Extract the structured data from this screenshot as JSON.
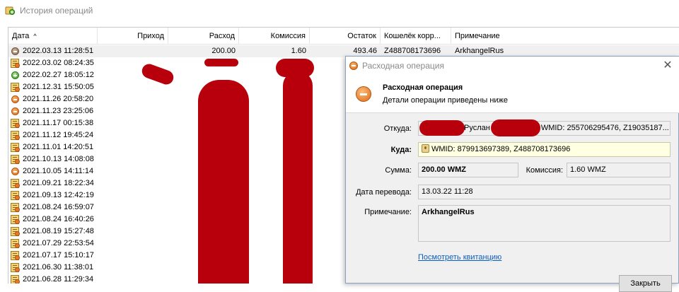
{
  "app": {
    "title": "История операций"
  },
  "table": {
    "columns": [
      "Дата",
      "Приход",
      "Расход",
      "Комиссия",
      "Остаток",
      "Кошелёк корр...",
      "Примечание"
    ],
    "sort_indicator": "^",
    "rows": [
      {
        "date": "2022.03.13 11:28:51",
        "icon": "grey-minus",
        "income": "",
        "expense": "200.00",
        "fee": "1.60",
        "balance": "493.46",
        "wallet": "Z488708173696",
        "note": "ArkhangelRus"
      },
      {
        "date": "2022.03.02 08:24:35",
        "icon": "doc"
      },
      {
        "date": "2022.02.27 18:05:12",
        "icon": "green-plus"
      },
      {
        "date": "2021.12.31 15:50:05",
        "icon": "doc"
      },
      {
        "date": "2021.11.26 20:58:20",
        "icon": "orange-minus"
      },
      {
        "date": "2021.11.23 23:25:06",
        "icon": "orange-minus"
      },
      {
        "date": "2021.11.17 00:15:38",
        "icon": "doc"
      },
      {
        "date": "2021.11.12 19:45:24",
        "icon": "doc"
      },
      {
        "date": "2021.11.01 14:20:51",
        "icon": "doc"
      },
      {
        "date": "2021.10.13 14:08:08",
        "icon": "doc"
      },
      {
        "date": "2021.10.05 14:11:14",
        "icon": "orange-minus"
      },
      {
        "date": "2021.09.21 18:22:34",
        "icon": "doc"
      },
      {
        "date": "2021.09.13 12:42:19",
        "icon": "doc"
      },
      {
        "date": "2021.08.24 16:59:07",
        "icon": "doc"
      },
      {
        "date": "2021.08.24 16:40:26",
        "icon": "doc"
      },
      {
        "date": "2021.08.19 15:27:48",
        "icon": "doc"
      },
      {
        "date": "2021.07.29 22:53:54",
        "icon": "doc"
      },
      {
        "date": "2021.07.17 15:10:17",
        "icon": "doc"
      },
      {
        "date": "2021.06.30 11:38:01",
        "icon": "doc"
      },
      {
        "date": "2021.06.28 11:29:34",
        "icon": "doc"
      }
    ]
  },
  "dialog": {
    "title": "Расходная операция",
    "close": "✕",
    "header_title": "Расходная операция",
    "header_subtitle": "Детали операции приведены ниже",
    "from_label": "Откуда:",
    "from_value_name": "Руслан",
    "from_value_wmid": "WMID: 255706295476, Z19035187...",
    "to_label": "Куда:",
    "to_value": "WMID: 879913697389, Z488708173696",
    "amount_label": "Сумма:",
    "amount_value": "200.00 WMZ",
    "fee_label": "Комиссия:",
    "fee_value": "1.60 WMZ",
    "date_label": "Дата перевода:",
    "date_value": "13.03.22 11:28",
    "note_label": "Примечание:",
    "note_value": "ArkhangelRus",
    "receipt_link": "Посмотреть квитанцию",
    "close_button": "Закрыть"
  },
  "colors": {
    "redaction": "#b8000c",
    "link": "#0b5ec2",
    "note_yellow": "#ffffe1"
  }
}
